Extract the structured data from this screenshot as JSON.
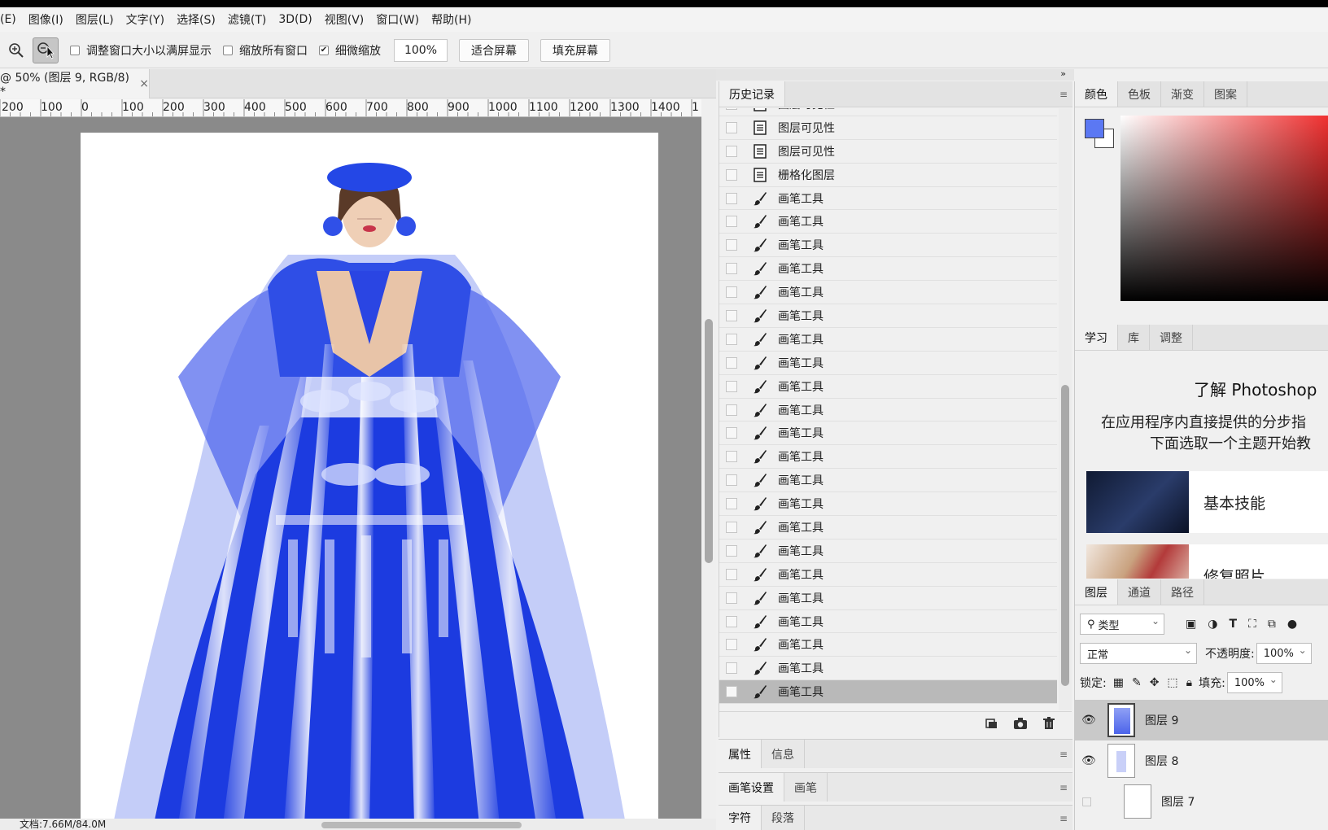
{
  "menu": [
    "(E)",
    "图像(I)",
    "图层(L)",
    "文字(Y)",
    "选择(S)",
    "滤镜(T)",
    "3D(D)",
    "视图(V)",
    "窗口(W)",
    "帮助(H)"
  ],
  "options": {
    "resize_windows": "调整窗口大小以满屏显示",
    "zoom_all": "缩放所有窗口",
    "scrubby_zoom": "细微缩放",
    "zoom_value": "100%",
    "fit_screen": "适合屏幕",
    "fill_screen": "填充屏幕"
  },
  "document": {
    "tab_title": "@ 50% (图层 9, RGB/8) *",
    "close": "×",
    "status": "文档:7.66M/84.0M"
  },
  "ruler_labels": [
    "200",
    "100",
    "0",
    "100",
    "200",
    "300",
    "400",
    "500",
    "600",
    "700",
    "800",
    "900",
    "1000",
    "1100",
    "1200",
    "1300",
    "1400",
    "1"
  ],
  "history": {
    "tab": "历史记录",
    "items": [
      {
        "label": "图层可见性",
        "icon": "document-icon"
      },
      {
        "label": "图层可见性",
        "icon": "document-icon"
      },
      {
        "label": "图层可见性",
        "icon": "document-icon"
      },
      {
        "label": "栅格化图层",
        "icon": "document-icon"
      },
      {
        "label": "画笔工具",
        "icon": "brush-icon"
      },
      {
        "label": "画笔工具",
        "icon": "brush-icon"
      },
      {
        "label": "画笔工具",
        "icon": "brush-icon"
      },
      {
        "label": "画笔工具",
        "icon": "brush-icon"
      },
      {
        "label": "画笔工具",
        "icon": "brush-icon"
      },
      {
        "label": "画笔工具",
        "icon": "brush-icon"
      },
      {
        "label": "画笔工具",
        "icon": "brush-icon"
      },
      {
        "label": "画笔工具",
        "icon": "brush-icon"
      },
      {
        "label": "画笔工具",
        "icon": "brush-icon"
      },
      {
        "label": "画笔工具",
        "icon": "brush-icon"
      },
      {
        "label": "画笔工具",
        "icon": "brush-icon"
      },
      {
        "label": "画笔工具",
        "icon": "brush-icon"
      },
      {
        "label": "画笔工具",
        "icon": "brush-icon"
      },
      {
        "label": "画笔工具",
        "icon": "brush-icon"
      },
      {
        "label": "画笔工具",
        "icon": "brush-icon"
      },
      {
        "label": "画笔工具",
        "icon": "brush-icon"
      },
      {
        "label": "画笔工具",
        "icon": "brush-icon"
      },
      {
        "label": "画笔工具",
        "icon": "brush-icon"
      },
      {
        "label": "画笔工具",
        "icon": "brush-icon"
      },
      {
        "label": "画笔工具",
        "icon": "brush-icon"
      },
      {
        "label": "画笔工具",
        "icon": "brush-icon"
      },
      {
        "label": "画笔工具",
        "icon": "brush-icon",
        "selected": true
      }
    ]
  },
  "properties": {
    "tabs": [
      "属性",
      "信息"
    ]
  },
  "brush": {
    "tabs": [
      "画笔设置",
      "画笔"
    ]
  },
  "character": {
    "tabs": [
      "字符",
      "段落"
    ]
  },
  "color": {
    "tabs": [
      "颜色",
      "色板",
      "渐变",
      "图案"
    ],
    "foreground": "#5b78f3",
    "background": "#ffffff"
  },
  "learn": {
    "tabs": [
      "学习",
      "库",
      "调整"
    ],
    "title": "了解 Photoshop",
    "line1": "在应用程序内直接提供的分步指",
    "line2": "下面选取一个主题开始教",
    "cards": [
      "基本技能",
      "修复照片"
    ]
  },
  "layers": {
    "tabs": [
      "图层",
      "通道",
      "路径"
    ],
    "filter": "类型",
    "blend": "正常",
    "opacity_label": "不透明度:",
    "opacity": "100%",
    "lock_label": "锁定:",
    "fill_label": "填充:",
    "fill": "100%",
    "items": [
      {
        "name": "图层 9",
        "visible": true,
        "selected": true
      },
      {
        "name": "图层 8",
        "visible": true,
        "selected": false
      },
      {
        "name": "图层 7",
        "visible": false,
        "selected": false
      }
    ]
  },
  "accent": "#1f3de0"
}
